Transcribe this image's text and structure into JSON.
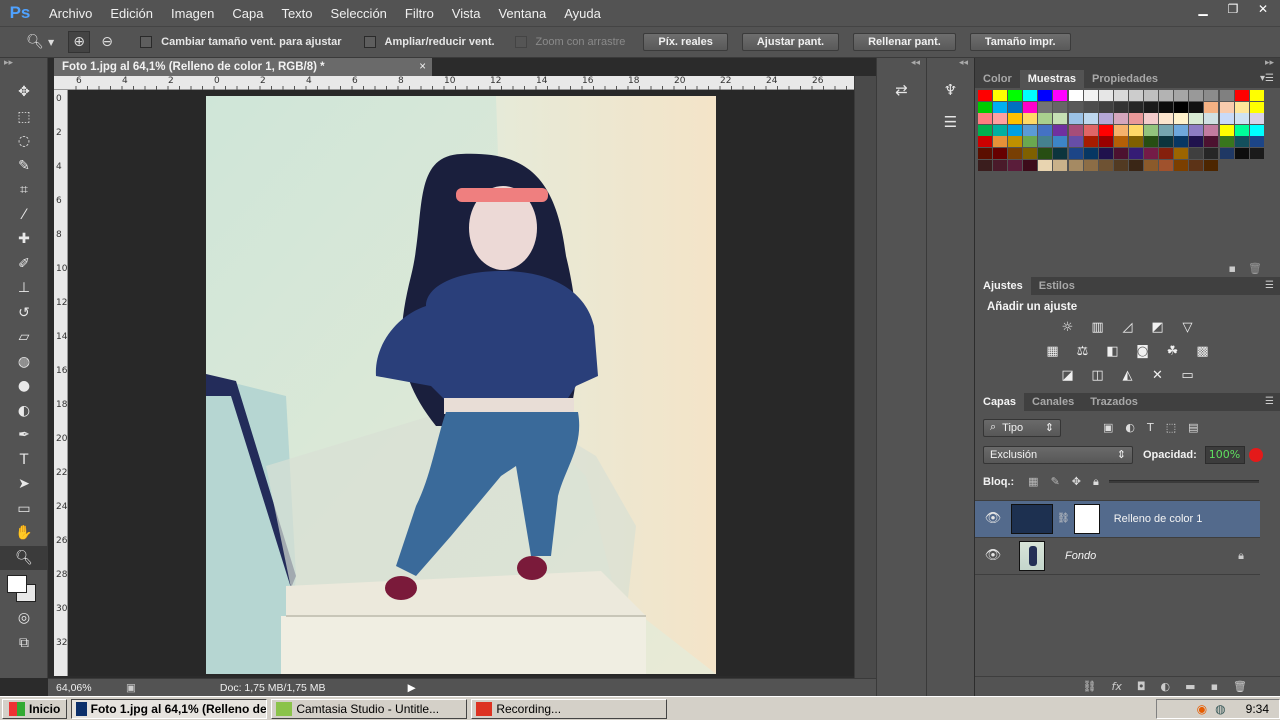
{
  "app": {
    "logo": "Ps"
  },
  "menu": [
    "Archivo",
    "Edición",
    "Imagen",
    "Capa",
    "Texto",
    "Selección",
    "Filtro",
    "Vista",
    "Ventana",
    "Ayuda"
  ],
  "options": {
    "cb1": "Cambiar tamaño vent. para ajustar",
    "cb2": "Ampliar/reducir vent.",
    "cb3": "Zoom con arrastre",
    "btn1": "Píx. reales",
    "btn2": "Ajustar pant.",
    "btn3": "Rellenar pant.",
    "btn4": "Tamaño impr."
  },
  "document": {
    "tab_title": "Foto 1.jpg al 64,1% (Relleno de color 1, RGB/8) *",
    "close": "×"
  },
  "ruler_top": [
    "6",
    "4",
    "2",
    "0",
    "2",
    "4",
    "6",
    "8",
    "10",
    "12",
    "14",
    "16",
    "18",
    "20",
    "22",
    "24",
    "26"
  ],
  "ruler_left": [
    "0",
    "2",
    "4",
    "6",
    "8",
    "10",
    "12",
    "14",
    "16",
    "18",
    "20",
    "22",
    "24",
    "26",
    "28",
    "30",
    "32"
  ],
  "status": {
    "zoom": "64,06%",
    "doc": "Doc: 1,75 MB/1,75 MB"
  },
  "panels": {
    "tabs1": [
      "Color",
      "Muestras",
      "Propiedades"
    ],
    "tabs2": [
      "Ajustes",
      "Estilos"
    ],
    "adj_title": "Añadir un ajuste",
    "tabs3": [
      "Capas",
      "Canales",
      "Trazados"
    ],
    "filter": "Tipo",
    "blend": "Exclusión",
    "opacity_label": "Opacidad:",
    "opacity": "100%",
    "lock_label": "Bloq.:",
    "layers": [
      {
        "name": "Relleno de color 1",
        "selected": true
      },
      {
        "name": "Fondo",
        "selected": false
      }
    ]
  },
  "swatch_colors": [
    "#ff0000",
    "#ffff00",
    "#00ff00",
    "#00ffff",
    "#0000ff",
    "#ff00ff",
    "#ffffff",
    "#f2f2f2",
    "#e6e6e6",
    "#d9d9d9",
    "#cccccc",
    "#bfbfbf",
    "#b3b3b3",
    "#a6a6a6",
    "#999999",
    "#8c8c8c",
    "#808080",
    "#ff0000",
    "#ffff00",
    "#00cc00",
    "#00b0f0",
    "#0070c0",
    "#ff00cc",
    "#737373",
    "#666666",
    "#595959",
    "#4d4d4d",
    "#404040",
    "#333333",
    "#262626",
    "#1a1a1a",
    "#0d0d0d",
    "#000000",
    "#111111",
    "#f4b183",
    "#f8cbad",
    "#ffe699",
    "#ffff00",
    "#ff7c80",
    "#ffa0a0",
    "#ffc000",
    "#ffd966",
    "#a9d08e",
    "#c6e0b4",
    "#9bc2e6",
    "#bdd7ee",
    "#b4a7d6",
    "#d5a6bd",
    "#ea9999",
    "#f4cccc",
    "#fce5cd",
    "#fff2cc",
    "#d9ead3",
    "#d0e0e3",
    "#c9daf8",
    "#cfe2f3",
    "#d9d2e9",
    "#00b050",
    "#00b0a0",
    "#00a0e0",
    "#5b9bd5",
    "#4472c4",
    "#7030a0",
    "#a64d79",
    "#e06666",
    "#ff0000",
    "#f6b26b",
    "#ffd966",
    "#93c47d",
    "#76a5af",
    "#6fa8dc",
    "#8e7cc3",
    "#c27ba0",
    "#ffff00",
    "#00ff99",
    "#00ffff",
    "#cc0000",
    "#e69138",
    "#bf9000",
    "#6aa84f",
    "#45818e",
    "#3d85c6",
    "#674ea7",
    "#a61c00",
    "#990000",
    "#b45f06",
    "#7f6000",
    "#274e13",
    "#0c343d",
    "#073763",
    "#20124d",
    "#4c1130",
    "#38761d",
    "#134f5c",
    "#1c4587",
    "#5b0f00",
    "#660000",
    "#783f04",
    "#7f6000",
    "#274e13",
    "#0c343d",
    "#1c4587",
    "#073763",
    "#20124d",
    "#4c1130",
    "#351c75",
    "#741b47",
    "#85200c",
    "#9c6500",
    "#3f3f3f",
    "#262626",
    "#1f3864",
    "#0d0d0d",
    "#1a1a1a",
    "#3a1d1d",
    "#4a1a2a",
    "#5a1d3a",
    "#3d0c1a",
    "#e8d4b0",
    "#c9b18a",
    "#a58a63",
    "#8c6d46",
    "#6e5233",
    "#523a22",
    "#3a2616",
    "#8b5a2b",
    "#a0522d",
    "#7b3f00",
    "#5c3317",
    "#4d2600",
    "",
    "",
    ""
  ]
}
